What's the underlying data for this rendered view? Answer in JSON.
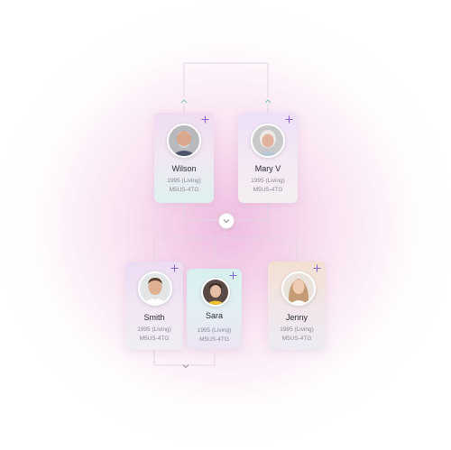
{
  "colors": {
    "accent": "#8a63d2",
    "text": "#2b2b35",
    "muted": "#8a8a98",
    "connector": "#e3d6e4"
  },
  "icons": {
    "plus": "plus-icon",
    "expand_up": "chevron-up-icon",
    "expand_down": "chevron-down-icon"
  },
  "tree": {
    "parents": [
      {
        "name": "Wilson",
        "year": "1995 (Living)",
        "code": "M5US-4TG"
      },
      {
        "name": "Mary V",
        "year": "1995 (Living)",
        "code": "M5US-4TG"
      }
    ],
    "children": [
      {
        "name": "Smith",
        "year": "1995 (Living)",
        "code": "M5US-4TG"
      },
      {
        "name": "Sara",
        "year": "1995 (Living)",
        "code": "M5US-4TG"
      },
      {
        "name": "Jenny",
        "year": "1995 (Living)",
        "code": "M5US-4TG"
      }
    ]
  }
}
